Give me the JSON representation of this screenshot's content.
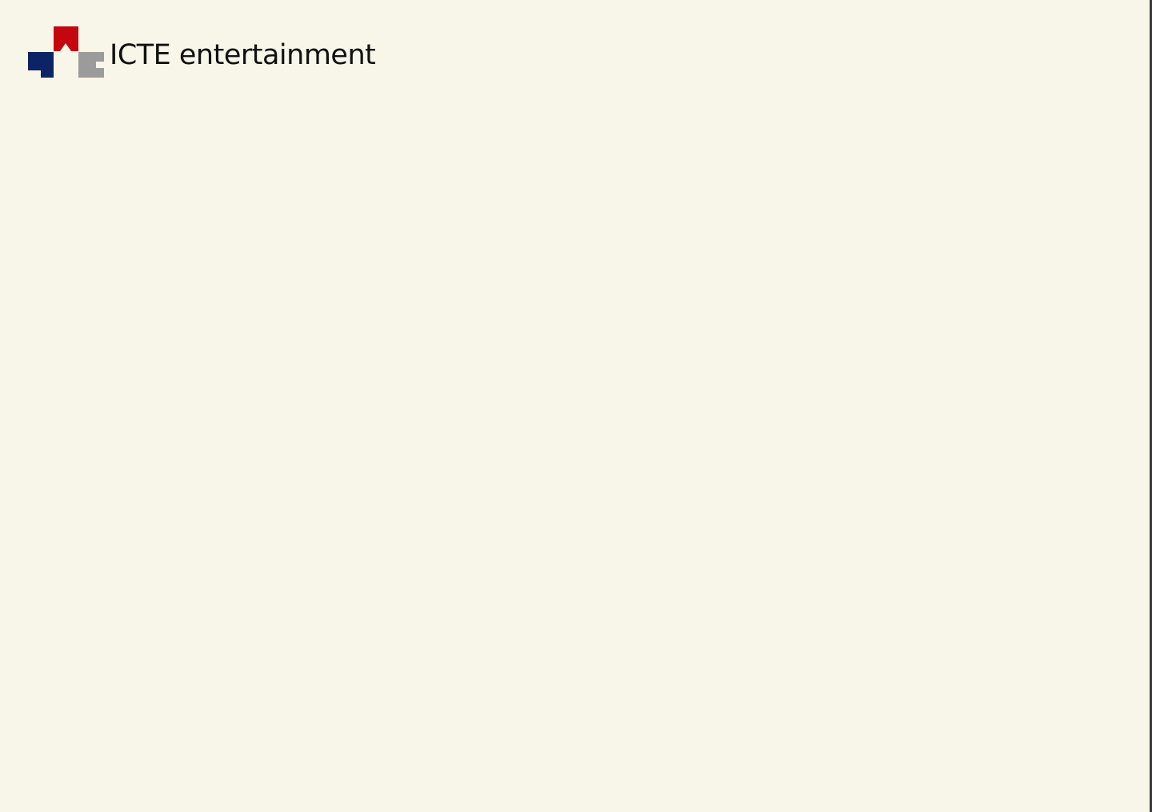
{
  "header": {
    "brand_name": "ICTE entertainment",
    "logo_icon": "icte-logo-icon"
  },
  "colors": {
    "background": "#f8f5e9",
    "logo_red": "#c4070f",
    "logo_navy": "#0c2466",
    "logo_gray": "#9b9b9b",
    "text": "#111111"
  }
}
